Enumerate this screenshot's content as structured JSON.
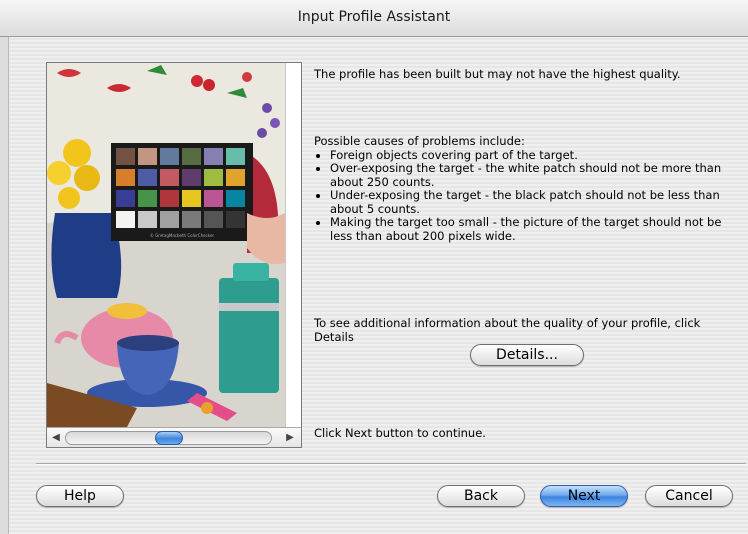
{
  "window": {
    "title": "Input Profile Assistant"
  },
  "main": {
    "quality_note": "The profile has been built but may not have the highest quality.",
    "causes_title": "Possible causes of problems include:",
    "causes": [
      "Foreign objects covering part of the target.",
      "Over-exposing the target - the white patch should not be more than about 250 counts.",
      "Under-exposing the target - the black patch should not be less than about 5 counts.",
      "Making the target too small - the picture of the target should not be less than about 200 pixels wide."
    ],
    "details_note": "To see additional information about the quality of your profile, click Details",
    "details_label": "Details...",
    "continue_note": "Click Next button to continue."
  },
  "footer": {
    "help_label": "Help",
    "back_label": "Back",
    "next_label": "Next",
    "cancel_label": "Cancel"
  },
  "image": {
    "checker_caption": "© GretagMacbeth ColorChecker",
    "hscroll_position": 0.5
  }
}
